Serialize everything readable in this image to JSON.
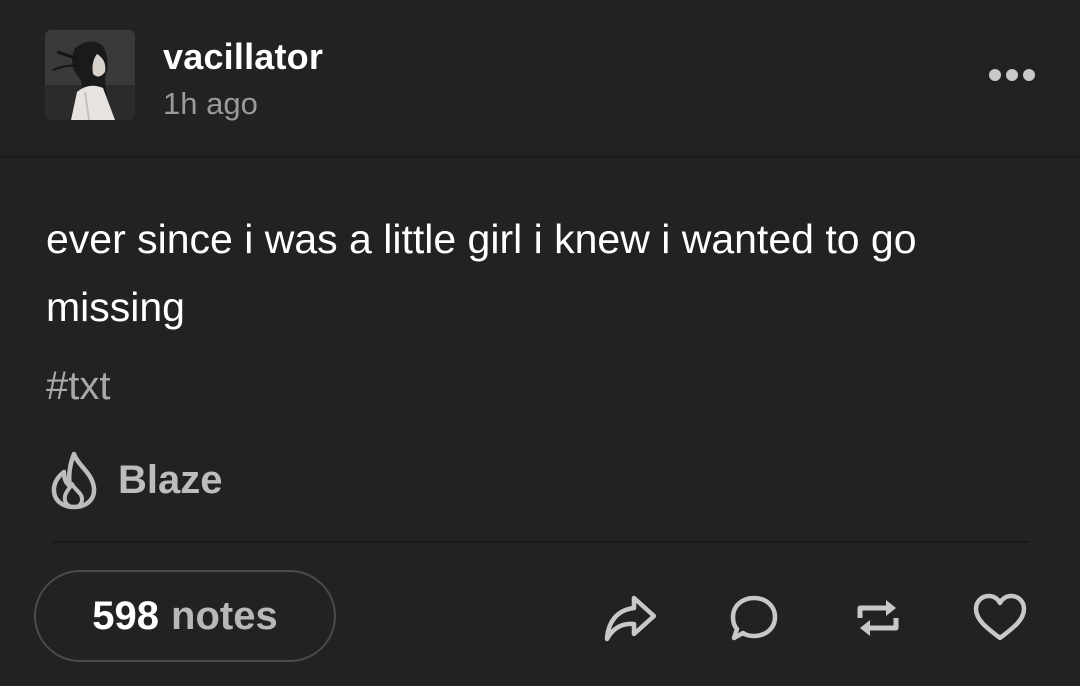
{
  "post": {
    "author": {
      "username": "vacillator",
      "timestamp": "1h ago",
      "avatar_icon": "avatar-photo"
    },
    "more_icon": "more-options-icon",
    "body_text": "ever since i was a little girl i knew i wanted to go missing",
    "tags": [
      "#txt"
    ],
    "blaze": {
      "label": "Blaze",
      "icon": "flame-icon"
    }
  },
  "footer": {
    "notes_count": "598",
    "notes_label": "notes",
    "actions": [
      {
        "name": "share",
        "icon": "share-icon"
      },
      {
        "name": "reply",
        "icon": "comment-icon"
      },
      {
        "name": "reblog",
        "icon": "reblog-icon"
      },
      {
        "name": "like",
        "icon": "heart-icon"
      }
    ]
  },
  "colors": {
    "background": "#222222",
    "primary_text": "#ffffff",
    "secondary_text": "#9a9a9a",
    "icon": "#c8c8c8",
    "pill_border": "#4a4a4a"
  }
}
